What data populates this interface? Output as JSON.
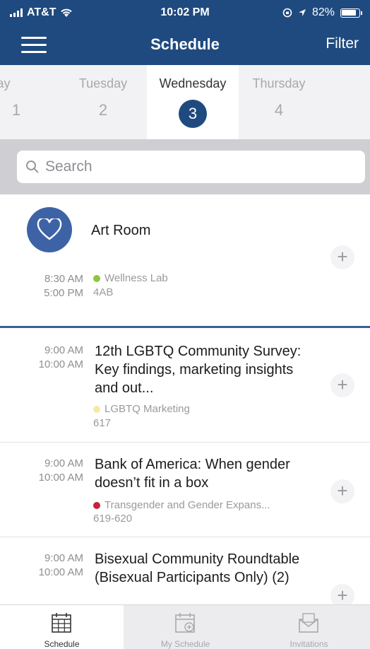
{
  "status": {
    "carrier": "AT&T",
    "time": "10:02 PM",
    "battery": "82%"
  },
  "nav": {
    "title": "Schedule",
    "filter_label": "Filter"
  },
  "days": [
    {
      "name": "nday",
      "num": "1"
    },
    {
      "name": "Tuesday",
      "num": "2"
    },
    {
      "name": "Wednesday",
      "num": "3",
      "active": true
    },
    {
      "name": "Thursday",
      "num": "4"
    }
  ],
  "search": {
    "placeholder": "Search"
  },
  "sessions": [
    {
      "title": "Art Room",
      "start": "8:30 AM",
      "end": "5:00 PM",
      "track": "Wellness Lab",
      "track_color": "#8cc63f",
      "room": "4AB",
      "icon": "heart-icon"
    },
    {
      "title": "12th LGBTQ Community Survey: Key findings, marketing insights and out...",
      "start": "9:00 AM",
      "end": "10:00 AM",
      "track": "LGBTQ Marketing",
      "track_color": "#f5e9a6",
      "room": "617"
    },
    {
      "title": "Bank of America: When gender doesn’t fit in a box",
      "start": "9:00 AM",
      "end": "10:00 AM",
      "track": "Transgender and Gender Expans...",
      "track_color": "#c4243b",
      "room": "619-620"
    },
    {
      "title": "Bisexual Community Roundtable (Bisexual Participants Only) (2)",
      "start": "9:00 AM",
      "end": "10:00 AM"
    }
  ],
  "tabs": [
    {
      "label": "Schedule",
      "icon": "calendar-icon",
      "active": true
    },
    {
      "label": "My Schedule",
      "icon": "calendar-add-icon"
    },
    {
      "label": "Invitations",
      "icon": "envelope-icon"
    }
  ],
  "plus_label": "+"
}
